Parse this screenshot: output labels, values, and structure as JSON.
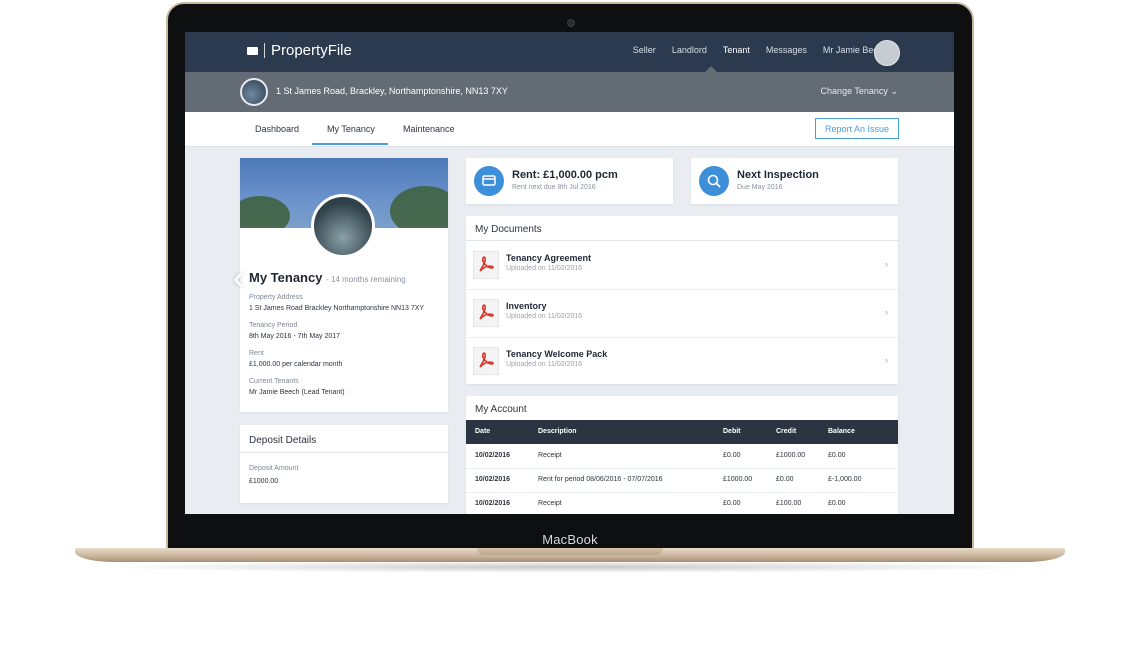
{
  "device": {
    "brand": "MacBook"
  },
  "app": {
    "logo": "PropertyFile",
    "nav": [
      "Seller",
      "Landlord",
      "Tenant",
      "Messages"
    ],
    "active_nav": "Tenant",
    "user_name": "Mr Jamie Beech",
    "address": "1 St James Road, Brackley, Northamptonshire, NN13 7XY",
    "change_tenancy": "Change Tenancy",
    "tabs": [
      "Dashboard",
      "My Tenancy",
      "Maintenance"
    ],
    "active_tab": "My Tenancy",
    "report_button": "Report An Issue"
  },
  "tenancy": {
    "title": "My Tenancy",
    "remaining": "- 14 months remaining",
    "fields": [
      {
        "label": "Property Address",
        "value": "1 St James Road Brackley Northamptonshire NN13 7XY"
      },
      {
        "label": "Tenancy Period",
        "value": "8th May 2016 - 7th May 2017"
      },
      {
        "label": "Rent",
        "value": "£1,000.00 per calendar month"
      },
      {
        "label": "Current Tenants",
        "value": "Mr Jamie Beech (Lead Tenant)"
      }
    ]
  },
  "deposit": {
    "title": "Deposit Details",
    "label": "Deposit Amount",
    "value": "£1000.00"
  },
  "stats": {
    "rent": {
      "title": "Rent: £1,000.00 pcm",
      "sub": "Rent next due 8th Jul 2016",
      "icon": "card-icon"
    },
    "inspection": {
      "title": "Next Inspection",
      "sub": "Due May 2016",
      "icon": "search-icon"
    }
  },
  "documents": {
    "title": "My Documents",
    "items": [
      {
        "name": "Tenancy Agreement",
        "date": "Uploaded on 11/02/2016"
      },
      {
        "name": "Inventory",
        "date": "Uploaded on 11/02/2016"
      },
      {
        "name": "Tenancy Welcome Pack",
        "date": "Uploaded on 11/02/2016"
      }
    ]
  },
  "account": {
    "title": "My Account",
    "columns": [
      "Date",
      "Description",
      "Debit",
      "Credit",
      "Balance"
    ],
    "rows": [
      [
        "10/02/2016",
        "Receipt",
        "£0.00",
        "£1000.00",
        "£0.00"
      ],
      [
        "10/02/2016",
        "Rent for period 08/06/2016 - 07/07/2016",
        "£1000.00",
        "£0.00",
        "£-1,000.00"
      ],
      [
        "10/02/2016",
        "Receipt",
        "£0.00",
        "£100.00",
        "£0.00"
      ]
    ]
  },
  "colors": {
    "accent": "#3c8fd8",
    "topbar": "#2b3a4f",
    "addressbar": "#636b75",
    "pdf": "#d9342b"
  }
}
